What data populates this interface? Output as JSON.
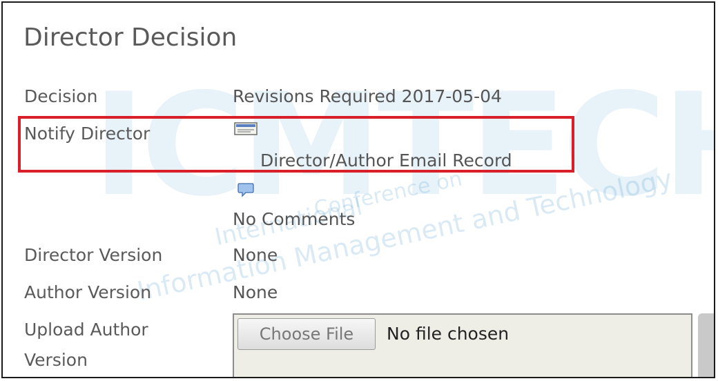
{
  "section_title": "Director Decision",
  "rows": {
    "decision": {
      "label": "Decision",
      "value": "Revisions Required 2017-05-04"
    },
    "notify_director": {
      "label": "Notify Director",
      "email_link": "Director/Author Email Record",
      "icon": "email-icon"
    },
    "comments": {
      "value": "No Comments",
      "icon": "comment-icon"
    },
    "director_version": {
      "label": "Director Version",
      "value": "None"
    },
    "author_version": {
      "label": "Author Version",
      "value": "None"
    },
    "upload_author_version": {
      "label_line1": "Upload Author",
      "label_line2": "Version",
      "choose_button": "Choose File",
      "file_status": "No file chosen"
    }
  },
  "watermark": {
    "logo": "ICMTECH",
    "line1": "Conference on",
    "line2": "International",
    "line3": "Information Management and Technology"
  },
  "colors": {
    "highlight": "#d81f2a",
    "watermark": "#2a8ac8",
    "text": "#555555"
  }
}
